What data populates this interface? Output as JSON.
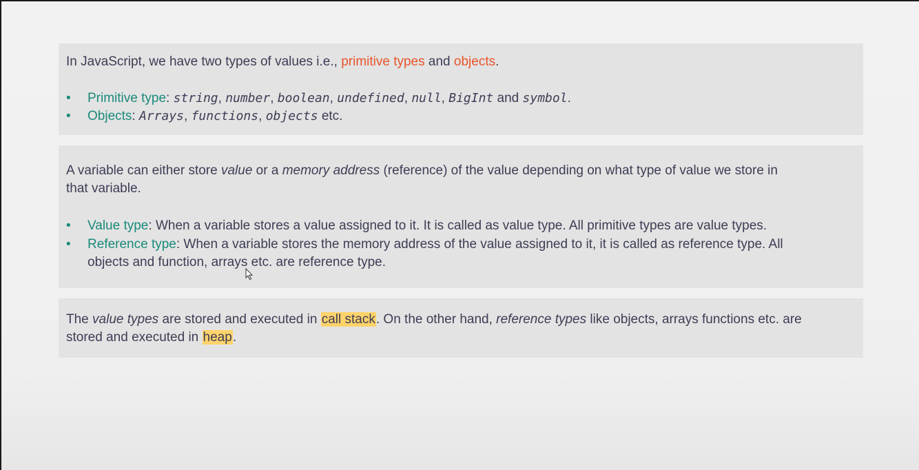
{
  "box1": {
    "intro_prefix": "In JavaScript, we have two types of values i.e.,",
    "intro_term1": "primitive types",
    "intro_and": "and",
    "intro_term2": "objects",
    "intro_end": ".",
    "bullet1": {
      "label": "Primitive type",
      "colon": ":",
      "items": [
        "string",
        "number",
        "boolean",
        "undefined",
        "null",
        "BigInt"
      ],
      "and": "and",
      "last": "symbol",
      "end": "."
    },
    "bullet2": {
      "label": "Objects",
      "colon": ":",
      "items": [
        "Arrays",
        "functions",
        "objects"
      ],
      "etc": "etc."
    }
  },
  "box2": {
    "line1_a": "A variable can either store",
    "line1_value": "value",
    "line1_b": "or a",
    "line1_memory": "memory address",
    "line1_c": "(reference) of the value depending on what type of value we store in",
    "line2": "that variable.",
    "bullet1": {
      "label": "Value type",
      "text": ": When a variable stores a value assigned to it. It is called as value type. All primitive types are value types."
    },
    "bullet2": {
      "label": "Reference type",
      "text": ": When a variable stores the memory address of the value assigned to it, it is called as reference type. All",
      "text2": "objects and function, arrays etc. are reference type."
    }
  },
  "box3": {
    "a": "The",
    "value_types": "value types",
    "b": "are stored and executed in",
    "call_stack": "call stack",
    "c": ". On the other hand,",
    "reference_types": "reference types",
    "d": "like objects, arrays functions etc. are",
    "line2_a": "stored and executed in",
    "heap": "heap",
    "line2_end": "."
  },
  "bullet_glyph": "•"
}
